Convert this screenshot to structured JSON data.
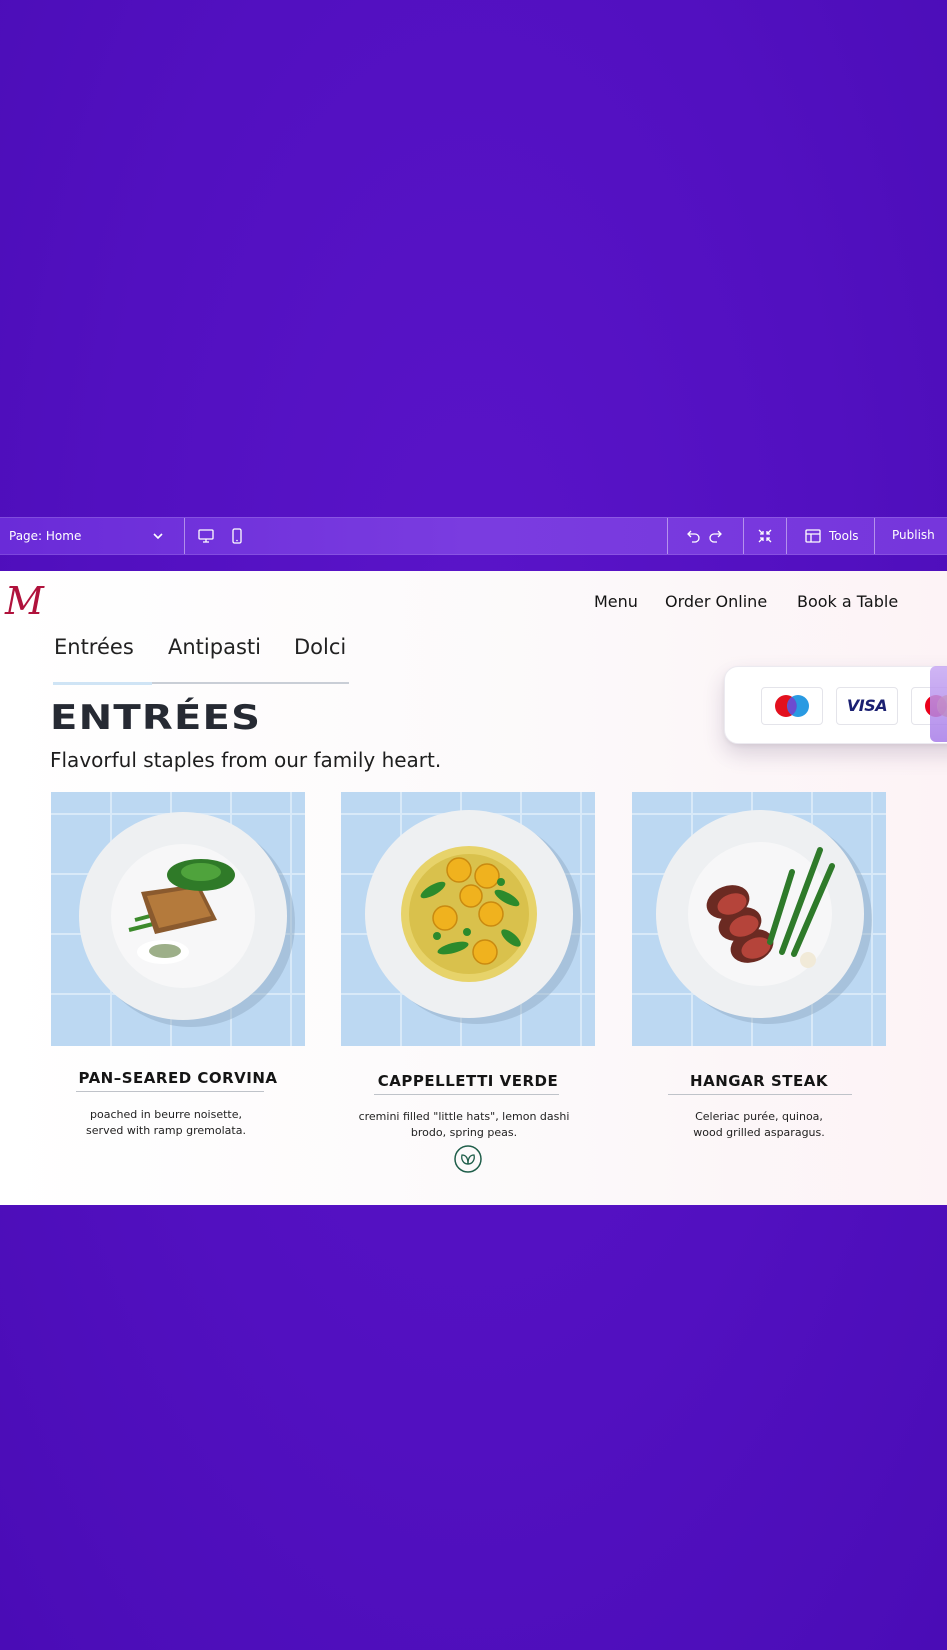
{
  "toolbar": {
    "page_label": "Page: Home",
    "tools_label": "Tools",
    "publish_label": "Publish"
  },
  "site": {
    "logo_letter": "M",
    "nav": [
      "Menu",
      "Order Online",
      "Book a Table"
    ],
    "tabs": [
      "Entrées",
      "Antipasti",
      "Dolci"
    ],
    "active_tab": "Entrées",
    "heading": "ENTRÉES",
    "subheading": "Flavorful staples from our family heart.",
    "payment_methods": [
      "maestro",
      "VISA",
      "mastercard"
    ],
    "dishes": [
      {
        "name": "PAN–SEARED CORVINA",
        "desc1": "poached in beurre noisette,",
        "desc2": "served with ramp gremolata.",
        "vegetarian": false
      },
      {
        "name": "CAPPELLETTI VERDE",
        "desc1": "cremini filled \"little hats\", lemon dashi",
        "desc2": "brodo, spring peas.",
        "vegetarian": true
      },
      {
        "name": "HANGAR STEAK",
        "desc1": "Celeriac purée, quinoa,",
        "desc2": "wood grilled asparagus.",
        "vegetarian": false
      }
    ]
  },
  "colors": {
    "background": "#5210c0",
    "toolbar": "#7636dc",
    "logo": "#b0123c",
    "heading": "#262a33",
    "tile_blue": "#bcd8f2",
    "veg_badge": "#1f5e4a"
  }
}
